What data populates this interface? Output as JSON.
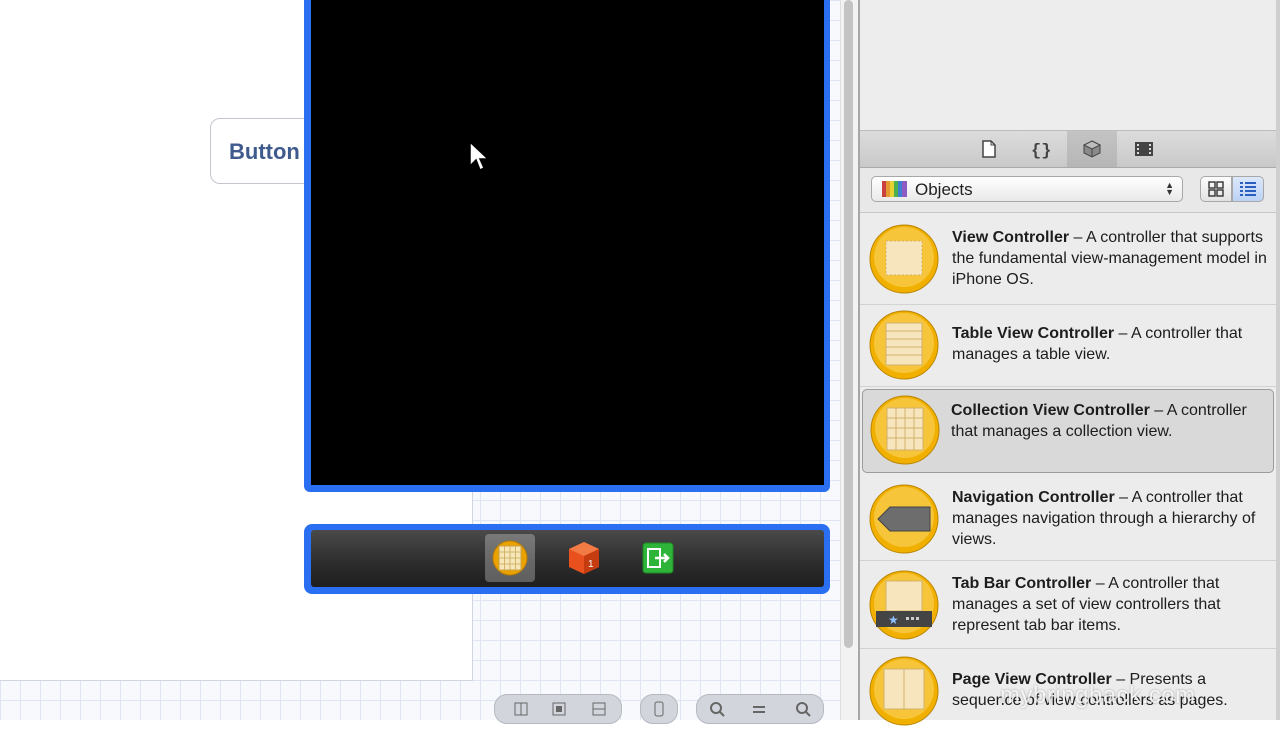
{
  "canvas": {
    "button_label": "Button"
  },
  "dock": {
    "items": [
      {
        "name": "collection-view-controller-icon",
        "selected": true
      },
      {
        "name": "first-responder-icon",
        "selected": false
      },
      {
        "name": "exit-icon",
        "selected": false
      }
    ]
  },
  "library": {
    "tabs": [
      "file-template-icon",
      "code-snippet-icon",
      "object-cube-icon",
      "media-icon"
    ],
    "active_tab": 2,
    "filter": {
      "selected": "Objects",
      "view_modes": [
        "grid-view-icon",
        "list-view-icon"
      ],
      "active_view": "list"
    },
    "items": [
      {
        "title": "View Controller",
        "description": " – A controller that supports the fundamental view-management model in iPhone OS.",
        "icon": "view-controller-icon"
      },
      {
        "title": "Table View Controller",
        "description": " – A controller that manages a table view.",
        "icon": "table-view-controller-icon"
      },
      {
        "title": "Collection View Controller",
        "description": " – A controller that manages a collection view.",
        "icon": "collection-view-controller-icon",
        "selected": true
      },
      {
        "title": "Navigation Controller",
        "description": " – A controller that manages navigation through a hierarchy of views.",
        "icon": "navigation-controller-icon"
      },
      {
        "title": "Tab Bar Controller",
        "description": " – A controller that manages a set of view controllers that represent tab bar items.",
        "icon": "tab-bar-controller-icon"
      },
      {
        "title": "Page View Controller",
        "description": " – Presents a sequence of view controllers as pages.",
        "icon": "page-view-controller-icon"
      }
    ]
  },
  "watermark": "mybringback.com",
  "colors": {
    "selection_blue": "#2a6ff2",
    "icon_gold": "#f0b400"
  }
}
